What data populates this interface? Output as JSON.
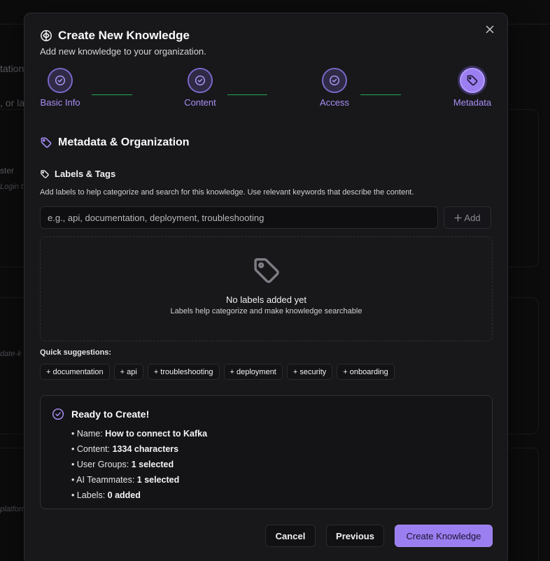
{
  "background": {
    "text_1": "tation",
    "text_2": ", or la",
    "text_3": "ster",
    "text_4": "Login t",
    "text_5": "date-k",
    "text_6": "platform"
  },
  "modal": {
    "title": "Create New Knowledge",
    "subtitle": "Add new knowledge to your organization.",
    "close_icon": "close-icon"
  },
  "steps": [
    {
      "label": "Basic Info",
      "status": "complete"
    },
    {
      "label": "Content",
      "status": "complete"
    },
    {
      "label": "Access",
      "status": "complete"
    },
    {
      "label": "Metadata",
      "status": "active"
    }
  ],
  "section": {
    "title": "Metadata & Organization",
    "labels_title": "Labels & Tags",
    "helper": "Add labels to help categorize and search for this knowledge. Use relevant keywords that describe the content."
  },
  "label_input": {
    "placeholder": "e.g., api, documentation, deployment, troubleshooting",
    "value": ""
  },
  "add_button": {
    "label": "Add"
  },
  "empty_state": {
    "title": "No labels added yet",
    "subtitle": "Labels help categorize and make knowledge searchable"
  },
  "quick_suggestions": {
    "label": "Quick suggestions:",
    "items": [
      "+ documentation",
      "+ api",
      "+ troubleshooting",
      "+ deployment",
      "+ security",
      "+ onboarding"
    ]
  },
  "ready": {
    "title": "Ready to Create!",
    "items": [
      {
        "key": "Name:",
        "value": "How to connect to Kafka"
      },
      {
        "key": "Content:",
        "value": "1334 characters"
      },
      {
        "key": "User Groups:",
        "value": "1 selected"
      },
      {
        "key": "AI Teammates:",
        "value": "1 selected"
      },
      {
        "key": "Labels:",
        "value": "0 added"
      }
    ]
  },
  "footer": {
    "cancel": "Cancel",
    "previous": "Previous",
    "create": "Create Knowledge"
  },
  "colors": {
    "accent": "#9b7ef0",
    "connector": "#22c55e",
    "modal_bg": "#18181b"
  }
}
